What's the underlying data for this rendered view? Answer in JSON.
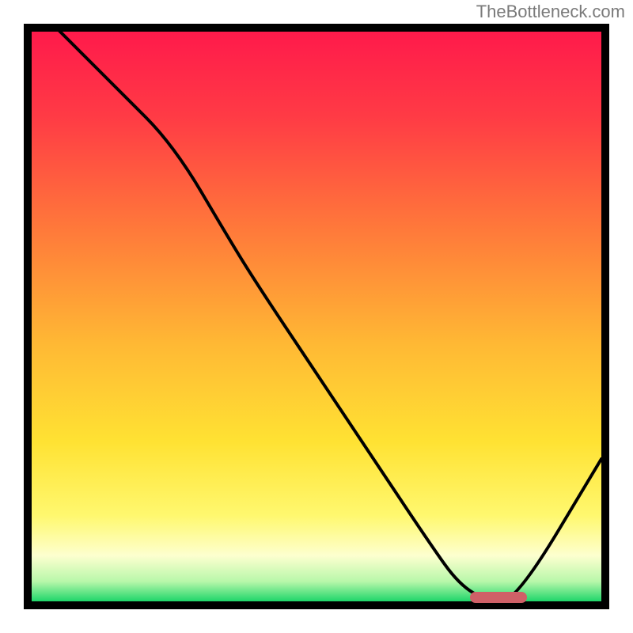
{
  "watermark": "TheBottleneck.com",
  "chart_data": {
    "type": "line",
    "title": "",
    "xlabel": "",
    "ylabel": "",
    "xlim": [
      0,
      100
    ],
    "ylim": [
      0,
      100
    ],
    "series": [
      {
        "name": "bottleneck-curve",
        "x": [
          0,
          5,
          15,
          25,
          35,
          40,
          50,
          60,
          70,
          75,
          80,
          85,
          100
        ],
        "y": [
          105,
          100,
          90,
          80,
          63,
          55,
          40,
          25,
          10,
          3,
          0,
          0,
          25
        ]
      }
    ],
    "optimal_range": {
      "x_start": 77,
      "x_end": 87,
      "y": 0
    },
    "background_gradient_stops": [
      {
        "pos": 0.0,
        "color": "#ff1a4b"
      },
      {
        "pos": 0.15,
        "color": "#ff3b45"
      },
      {
        "pos": 0.35,
        "color": "#ff7a3a"
      },
      {
        "pos": 0.55,
        "color": "#ffb934"
      },
      {
        "pos": 0.72,
        "color": "#ffe233"
      },
      {
        "pos": 0.85,
        "color": "#fff86f"
      },
      {
        "pos": 0.92,
        "color": "#fdffcf"
      },
      {
        "pos": 0.965,
        "color": "#b8f7aa"
      },
      {
        "pos": 1.0,
        "color": "#1fd66a"
      }
    ]
  }
}
